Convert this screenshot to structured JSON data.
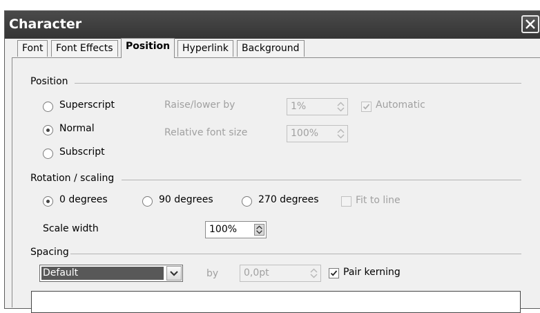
{
  "window": {
    "title": "Character"
  },
  "tabs": [
    "Font",
    "Font Effects",
    "Position",
    "Hyperlink",
    "Background"
  ],
  "active_tab": "Position",
  "position": {
    "group_label": "Position",
    "superscript_label": "Superscript",
    "normal_label": "Normal",
    "subscript_label": "Subscript",
    "selected": "Normal",
    "raise_lower_label": "Raise/lower by",
    "raise_lower_value": "1%",
    "automatic_label": "Automatic",
    "automatic_checked": true,
    "relative_size_label": "Relative font size",
    "relative_size_value": "100%"
  },
  "rotation": {
    "group_label": "Rotation / scaling",
    "deg0_label": "0 degrees",
    "deg90_label": "90 degrees",
    "deg270_label": "270 degrees",
    "selected": "0 degrees",
    "fit_to_line_label": "Fit to line",
    "fit_to_line_checked": false,
    "scale_width_label": "Scale width",
    "scale_width_value": "100%"
  },
  "spacing": {
    "group_label": "Spacing",
    "mode_value": "Default",
    "by_label": "by",
    "by_value": "0,0pt",
    "pair_kerning_label": "Pair kerning",
    "pair_kerning_checked": true
  },
  "colors": {
    "titlebar": "#3d3d3d",
    "dialog_bg": "#f0f0f0",
    "disabled_text": "#a0a0a0",
    "selection": "#585858"
  }
}
